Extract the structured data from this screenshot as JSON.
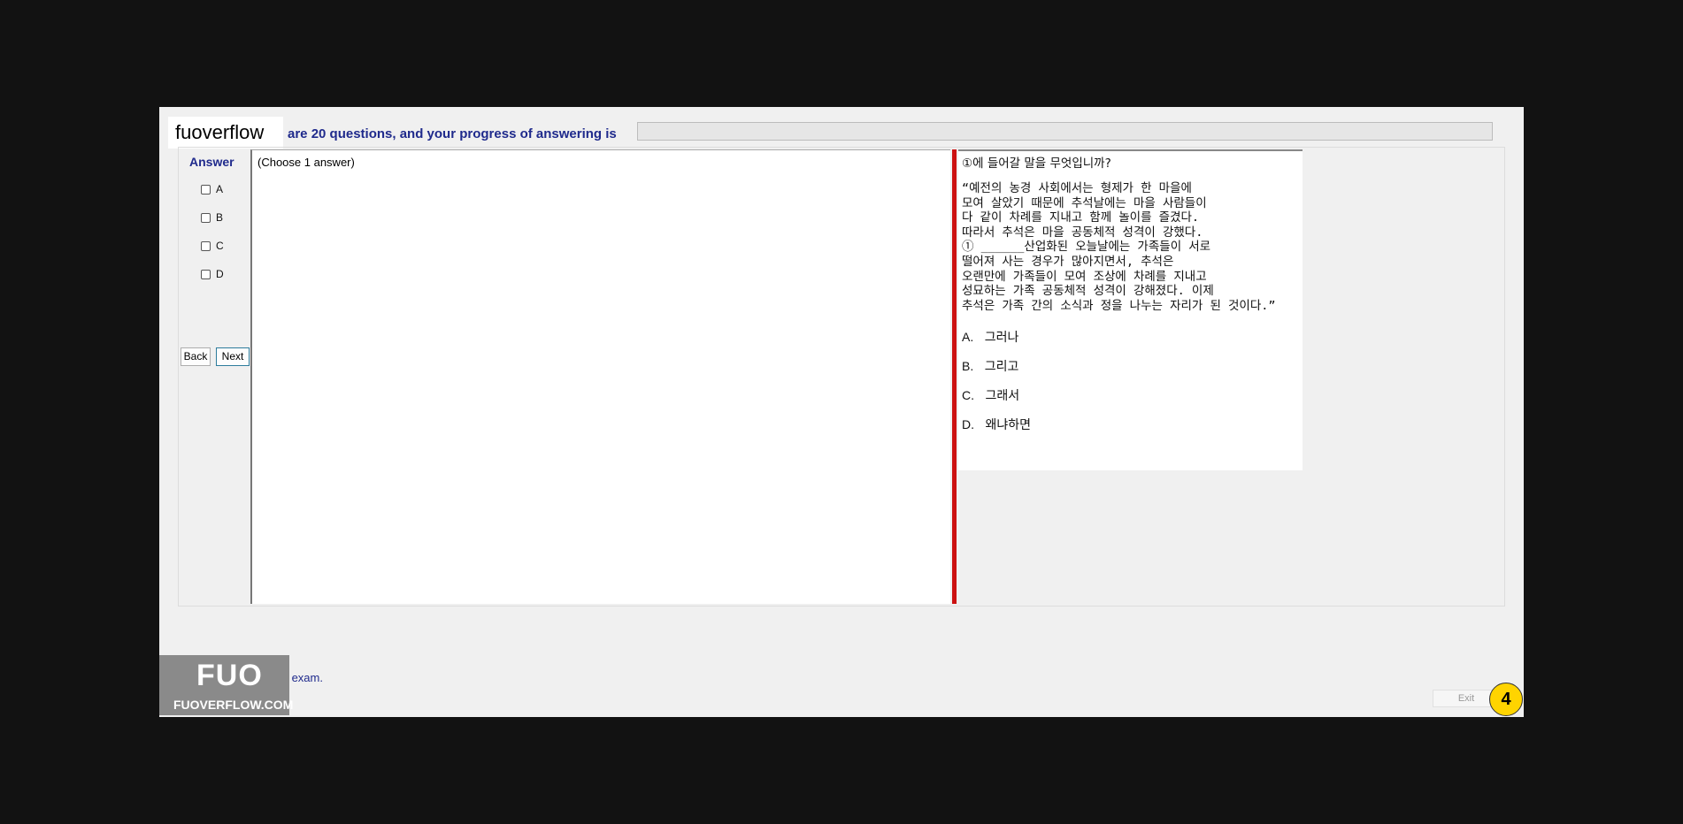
{
  "header": {
    "brand": "fuoverflow",
    "progress_text": "are 20 questions, and your progress of answering is",
    "progress_value": 0
  },
  "answer_panel": {
    "title": "Answer",
    "options": [
      "A",
      "B",
      "C",
      "D"
    ],
    "back_label": "Back",
    "next_label": "Next"
  },
  "answer_box": {
    "hint": "(Choose 1 answer)"
  },
  "question": {
    "head": "①에 들어갈 말을 무엇입니까?",
    "paragraph_lines": [
      "“예전의 농경 사회에서는 형제가 한 마을에",
      "모여 살았기 때문에 추석날에는 마을 사람들이",
      "다 같이 차례를 지내고 함께 놀이를 즐겼다.",
      "따라서 추석은 마을 공동체적 성격이 강했다.",
      "① ______산업화된 오늘날에는 가족들이 서로",
      "떨어져 사는 경우가 많아지면서, 추석은",
      "오랜만에 가족들이 모여 조상에 차례를 지내고",
      "성묘하는 가족 공동체적 성격이 강해졌다. 이제",
      "추석은 가족 간의 소식과 정을 나누는 자리가 된 것이다.”"
    ],
    "choices": [
      {
        "letter": "A.",
        "text": "그러나"
      },
      {
        "letter": "B.",
        "text": "그리고"
      },
      {
        "letter": "C.",
        "text": "그래서"
      },
      {
        "letter": "D.",
        "text": "왜냐하면"
      }
    ]
  },
  "footer": {
    "finish_label": "Want to finish the exam.",
    "logo_big": "FUO",
    "logo_small": "FUOVERFLOW.COM",
    "exit_label": "Exit",
    "page_number": "4"
  },
  "colors": {
    "accent_blue": "#1f2a8c",
    "splitter_red": "#cc1111",
    "badge_yellow": "#ffd400"
  }
}
